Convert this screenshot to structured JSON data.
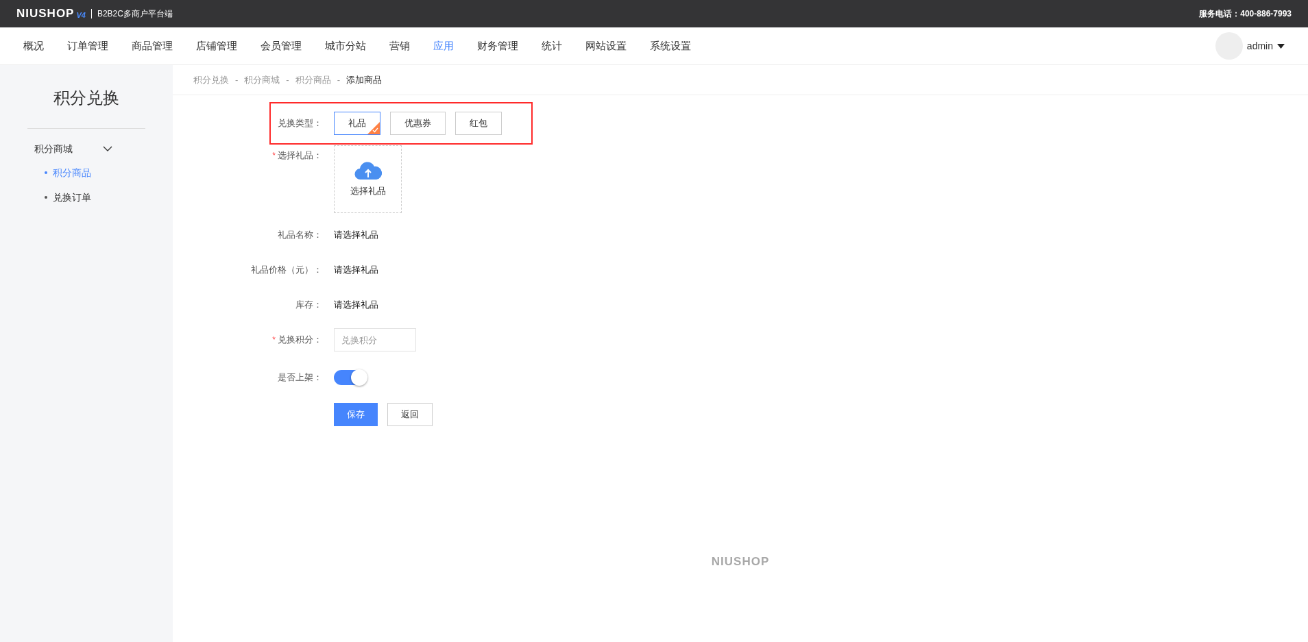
{
  "header": {
    "logo": "NIUSHOP",
    "logo_version": "V4",
    "platform": "B2B2C多商户平台端",
    "hotline": "服务电话：400-886-7993"
  },
  "nav": {
    "items": [
      {
        "label": "概况",
        "selected": false
      },
      {
        "label": "订单管理",
        "selected": false
      },
      {
        "label": "商品管理",
        "selected": false
      },
      {
        "label": "店铺管理",
        "selected": false
      },
      {
        "label": "会员管理",
        "selected": false
      },
      {
        "label": "城市分站",
        "selected": false
      },
      {
        "label": "营销",
        "selected": false
      },
      {
        "label": "应用",
        "selected": true
      },
      {
        "label": "财务管理",
        "selected": false
      },
      {
        "label": "统计",
        "selected": false
      },
      {
        "label": "网站设置",
        "selected": false
      },
      {
        "label": "系统设置",
        "selected": false
      }
    ],
    "user": "admin"
  },
  "sidebar": {
    "title": "积分兑换",
    "groups": [
      {
        "label": "积分商城",
        "expanded": true,
        "children": [
          {
            "label": "积分商品",
            "selected": true
          },
          {
            "label": "兑换订单",
            "selected": false
          }
        ]
      }
    ]
  },
  "breadcrumb": [
    "积分兑换",
    "积分商城",
    "积分商品",
    "添加商品"
  ],
  "breadcrumb_separator": "-",
  "required_mark": "*",
  "form": {
    "exchange_type": {
      "label": "兑换类型：",
      "options": [
        {
          "label": "礼品",
          "selected": true
        },
        {
          "label": "优惠券",
          "selected": false
        },
        {
          "label": "红包",
          "selected": false
        }
      ]
    },
    "fields": [
      {
        "kind": "picker",
        "label": "选择礼品：",
        "required": true,
        "text": "选择礼品"
      },
      {
        "kind": "text",
        "label": "礼品名称：",
        "required": false,
        "value": "请选择礼品"
      },
      {
        "kind": "text",
        "label": "礼品价格（元）：",
        "required": false,
        "value": "请选择礼品"
      },
      {
        "kind": "text",
        "label": "库存：",
        "required": false,
        "value": "请选择礼品"
      },
      {
        "kind": "input",
        "label": "兑换积分：",
        "required": true,
        "placeholder": "兑换积分"
      },
      {
        "kind": "switch",
        "label": "是否上架：",
        "required": false,
        "on": true
      }
    ],
    "buttons": [
      {
        "label": "保存",
        "kind": "primary"
      },
      {
        "label": "返回",
        "kind": "default"
      }
    ]
  },
  "footer_logo": "NIUSHOP"
}
